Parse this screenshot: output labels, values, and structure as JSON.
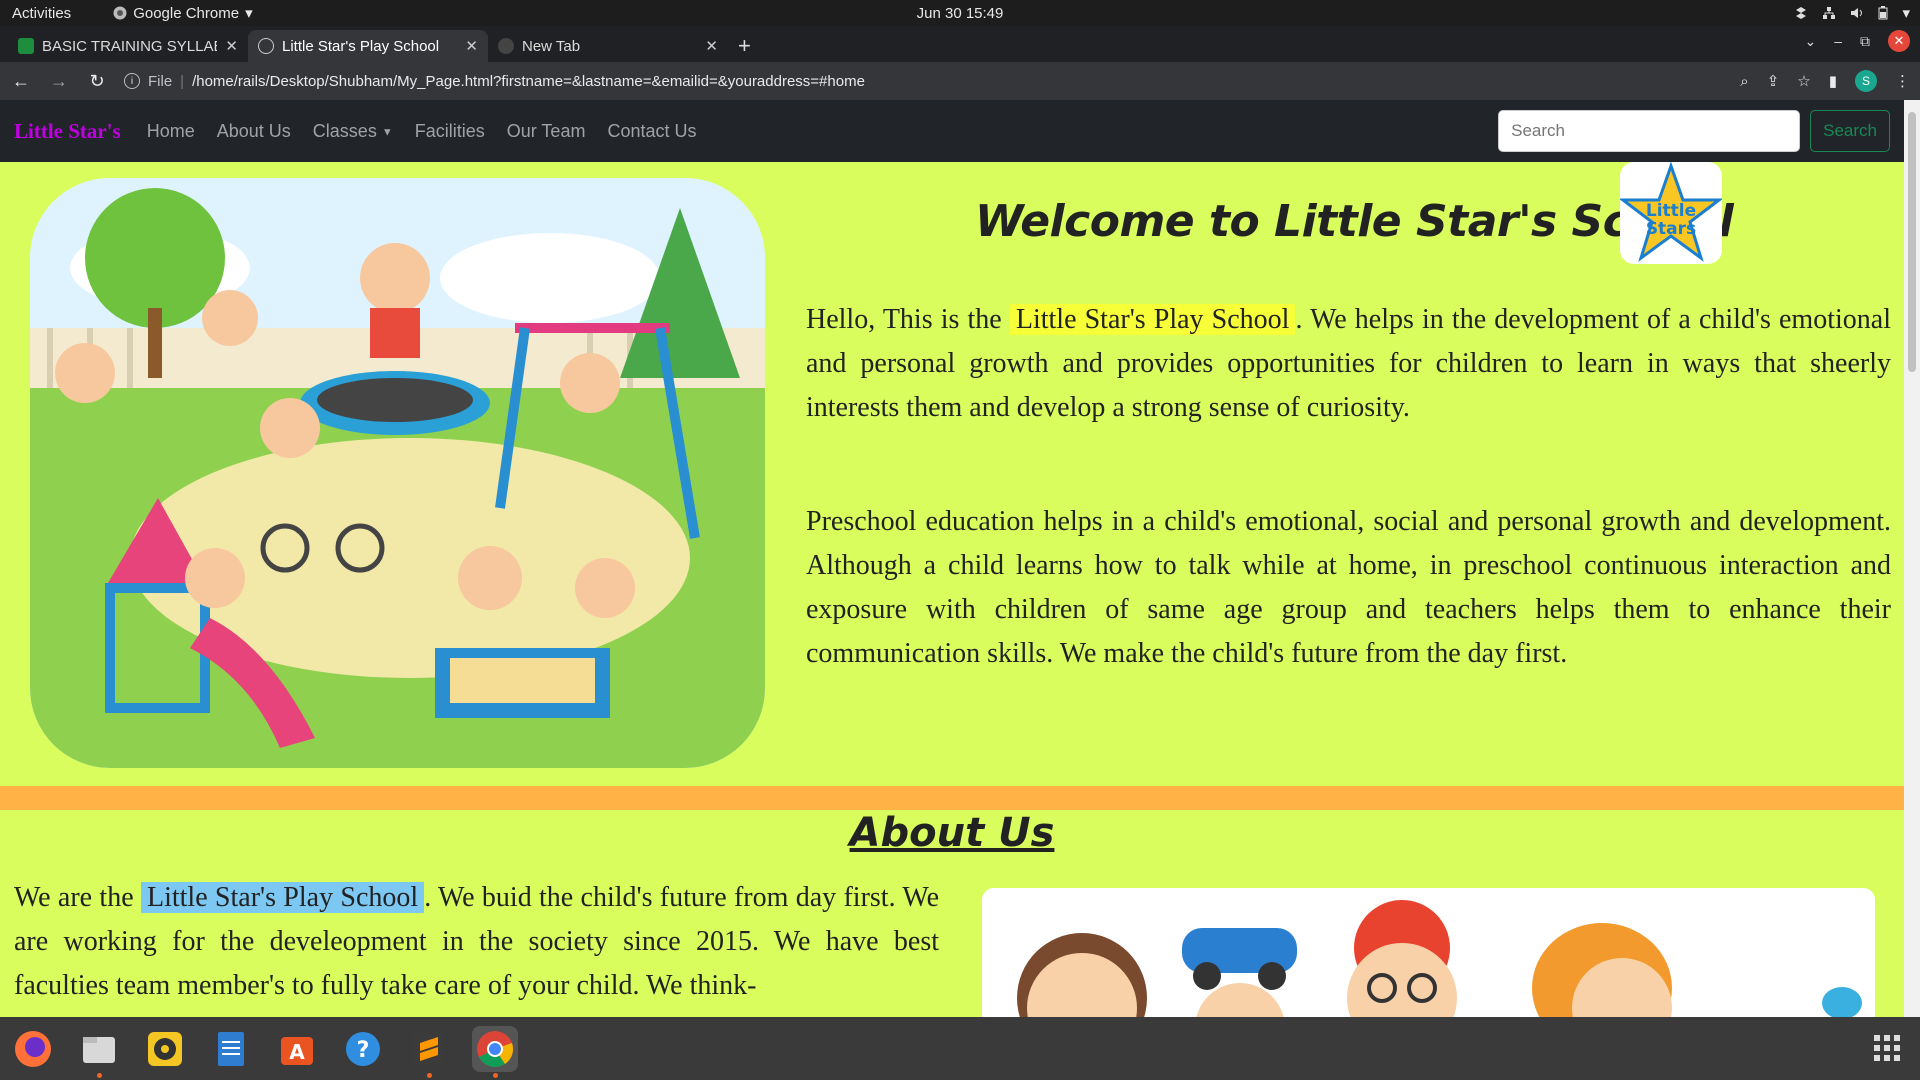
{
  "system": {
    "activities": "Activities",
    "app_name": "Google Chrome",
    "clock": "Jun 30  15:49"
  },
  "tabs": [
    {
      "title": "BASIC TRAINING SYLLABUS",
      "icon": "sheets-icon"
    },
    {
      "title": "Little Star's Play School",
      "icon": "globe-icon",
      "active": true
    },
    {
      "title": "New Tab",
      "icon": "chrome-icon"
    }
  ],
  "address_bar": {
    "scheme_label": "File",
    "url": "/home/rails/Desktop/Shubham/My_Page.html?firstname=&lastname=&emailid=&youraddress=#home"
  },
  "profile_initial": "S",
  "site": {
    "brand": "Little Star's",
    "brand_color": "#c000e0",
    "nav": [
      "Home",
      "About Us",
      "Classes",
      "Facilities",
      "Our Team",
      "Contact Us"
    ],
    "search_placeholder": "Search",
    "search_button": "Search",
    "hero": {
      "title": "Welcome to Little Star's School",
      "logo_text": "Little Stars",
      "p1_before": "Hello, This is the",
      "p1_highlight": "Little Star's Play School",
      "p1_after": ". We helps in the development of a child's emotional and personal growth and provides opportunities for children to learn in ways that sheerly interests them and develop a strong sense of curiosity.",
      "p2": "Preschool education helps in a child's emotional, social and personal growth and development. Although a child learns how to talk while at home, in preschool continuous interaction and exposure with children of same age group and teachers helps them to enhance their communication skills. We make the child's future from the day first."
    },
    "about": {
      "title": "About Us",
      "p_before": "We are the",
      "p_highlight": "Little Star's Play School",
      "p_after": ". We buid the child's future from day first. We are working for the develeopment in the society since 2015. We have best faculties team member's to fully take care of your child. We think-"
    },
    "colors": {
      "page_bg": "#d9fd5c",
      "navbar_bg": "#212529",
      "divider": "#ffb347",
      "highlight": "#f6ff38"
    }
  },
  "dock": [
    "firefox-icon",
    "files-icon",
    "rhythmbox-icon",
    "writer-icon",
    "software-icon",
    "help-icon",
    "sublime-icon",
    "chrome-icon"
  ]
}
